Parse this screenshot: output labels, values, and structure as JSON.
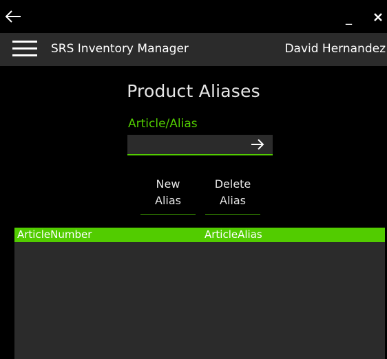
{
  "window": {
    "back_icon": "arrow-left-icon",
    "minimize_label": "_",
    "close_icon": "close-icon"
  },
  "appbar": {
    "menu_icon": "hamburger-icon",
    "title": "SRS Inventory Manager",
    "user": "David Hernandez"
  },
  "page": {
    "title": "Product Aliases"
  },
  "search": {
    "label": "Article/Alias",
    "value": "",
    "placeholder": "",
    "go_icon": "arrow-right-icon"
  },
  "actions": {
    "new_alias": "New\nAlias",
    "delete_alias": "Delete\nAlias"
  },
  "grid": {
    "columns": [
      "ArticleNumber",
      "ArticleAlias"
    ],
    "rows": []
  },
  "colors": {
    "accent": "#52cc00",
    "background": "#000000",
    "panel": "#2b2b2b",
    "text": "#ffffff"
  }
}
